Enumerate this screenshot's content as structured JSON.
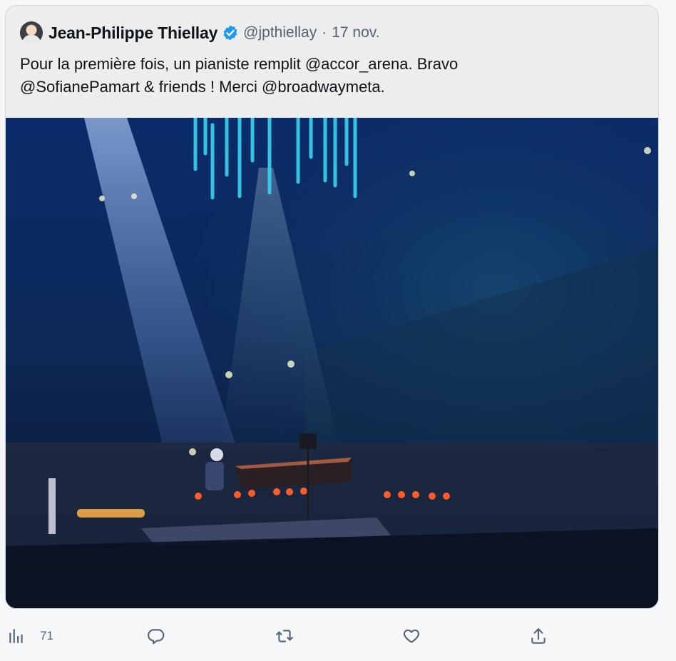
{
  "tweet": {
    "author_name": "Jean-Philippe Thiellay",
    "handle": "@jpthiellay",
    "separator": "·",
    "date": "17 nov.",
    "text_lines": [
      "Pour la première fois, un pianiste remplit @accor_arena. Bravo",
      "@SofianePamart & friends ! Merci @broadwaymeta."
    ],
    "verified": true,
    "media": {
      "description_icon": "concert-photo"
    }
  },
  "actions": {
    "views": {
      "icon": "bar-chart-icon",
      "count": "71"
    },
    "reply": {
      "icon": "reply-icon"
    },
    "retweet": {
      "icon": "retweet-icon"
    },
    "like": {
      "icon": "heart-icon"
    },
    "share": {
      "icon": "share-icon"
    }
  },
  "colors": {
    "verified_badge": "#1d9bf0",
    "muted_text": "#536471",
    "primary_text": "#0f1419",
    "card_background": "#ededed"
  }
}
